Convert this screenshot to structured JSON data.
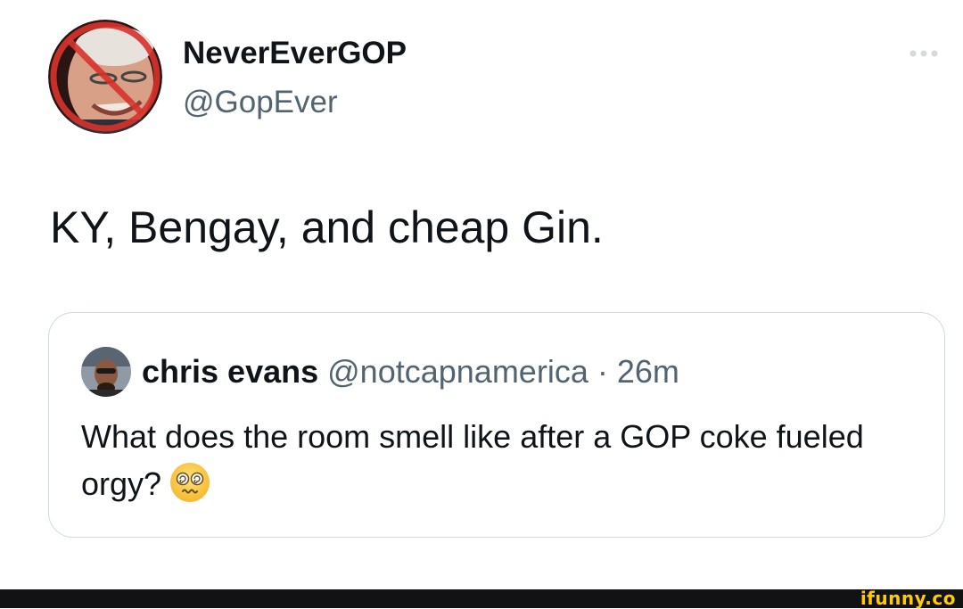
{
  "tweet": {
    "display_name": "NeverEverGOP",
    "handle": "@GopEver",
    "text": "KY, Bengay, and cheap Gin.",
    "more_icon": "more-horizontal-icon"
  },
  "quoted_tweet": {
    "display_name": "chris evans",
    "handle": "@notcapnamerica",
    "separator": "·",
    "time": "26m",
    "text": "What does the room smell like after a GOP coke fueled orgy?",
    "emoji": "dizzy-face-emoji"
  },
  "watermark": {
    "text": "ifunny.co"
  },
  "colors": {
    "text_primary": "#0f1419",
    "text_secondary": "#536471",
    "border": "#cfd9de",
    "prohibition_red": "#d8322b",
    "watermark_yellow": "#ffcc00",
    "footer_bar": "#121214"
  }
}
